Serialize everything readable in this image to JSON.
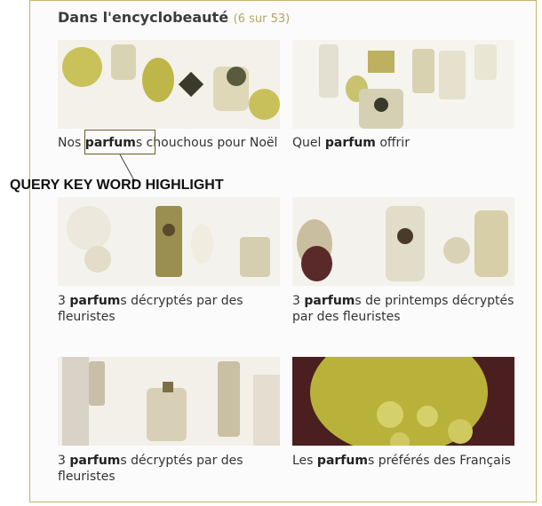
{
  "section": {
    "title": "Dans l'encyclobeauté",
    "count": "(6 sur 53)"
  },
  "annotation": {
    "label": "QUERY KEY WORD HIGHLIGHT"
  },
  "cards": [
    {
      "pre": "Nos ",
      "keyword": "parfum",
      "post": "s chouchous pour Noël"
    },
    {
      "pre": "Quel ",
      "keyword": "parfum",
      "post": " offrir"
    },
    {
      "pre": "3 ",
      "keyword": "parfum",
      "post": "s décryptés par des fleuristes"
    },
    {
      "pre": "3 ",
      "keyword": "parfum",
      "post": "s de printemps décryptés par des fleuristes"
    },
    {
      "pre": "3 ",
      "keyword": "parfum",
      "post": "s décryptés par des fleuristes"
    },
    {
      "pre": "Les ",
      "keyword": "parfum",
      "post": "s préférés des Français"
    }
  ],
  "colors": {
    "accent": "#b7a366",
    "border": "#c7b46a",
    "olive": "#b8b23a",
    "dark_wine": "#4b1f1f"
  }
}
